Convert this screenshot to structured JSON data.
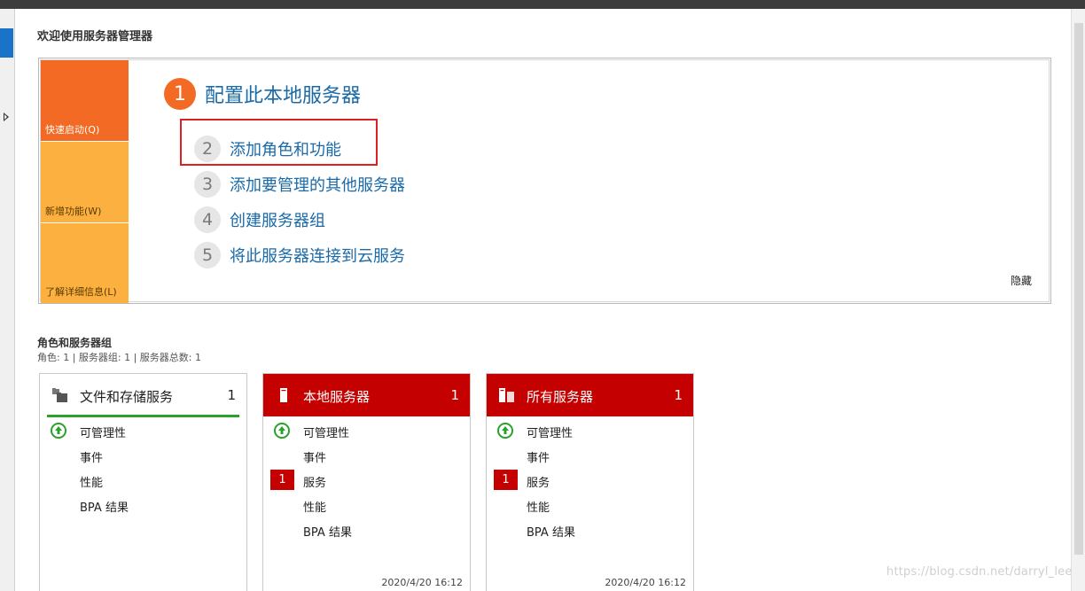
{
  "welcome_title": "欢迎使用服务器管理器",
  "quick_start": {
    "tiles": [
      "快速启动(Q)",
      "新增功能(W)",
      "了解详细信息(L)"
    ],
    "steps": [
      {
        "num": "1",
        "label": "配置此本地服务器"
      },
      {
        "num": "2",
        "label": "添加角色和功能"
      },
      {
        "num": "3",
        "label": "添加要管理的其他服务器"
      },
      {
        "num": "4",
        "label": "创建服务器组"
      },
      {
        "num": "5",
        "label": "将此服务器连接到云服务"
      }
    ],
    "hide_label": "隐藏"
  },
  "roles": {
    "title": "角色和服务器组",
    "subtitle": "角色: 1 | 服务器组: 1 | 服务器总数: 1",
    "cards": [
      {
        "title": "文件和存储服务",
        "count": "1",
        "rows": [
          "可管理性",
          "事件",
          "性能",
          "BPA 结果"
        ]
      },
      {
        "title": "本地服务器",
        "count": "1",
        "rows": [
          "可管理性",
          "事件",
          "服务",
          "性能",
          "BPA 结果"
        ],
        "service_badge": "1",
        "timestamp": "2020/4/20 16:12"
      },
      {
        "title": "所有服务器",
        "count": "1",
        "rows": [
          "可管理性",
          "事件",
          "服务",
          "性能",
          "BPA 结果"
        ],
        "service_badge": "1",
        "timestamp": "2020/4/20 16:12"
      }
    ]
  },
  "watermark": "https://blog.csdn.net/darryl_lee",
  "colors": {
    "accent_orange": "#f26a24",
    "tile_amber": "#fbb040",
    "alert_red": "#c40000",
    "ok_green": "#2aa12a",
    "link_blue": "#1a6aa8"
  }
}
